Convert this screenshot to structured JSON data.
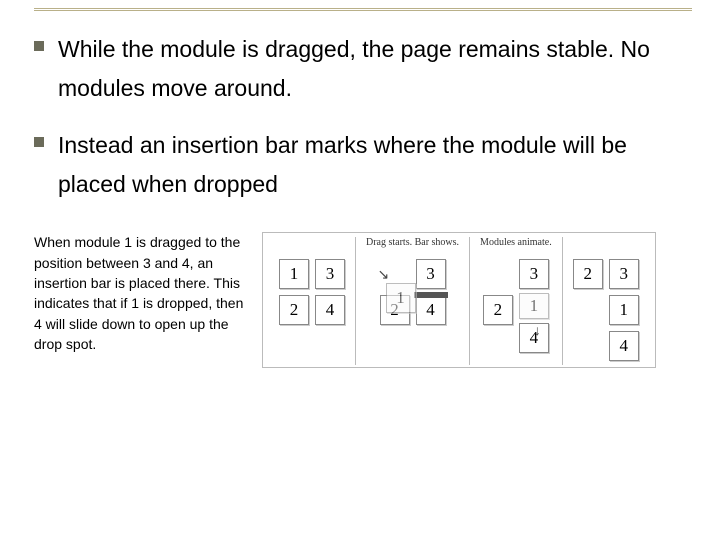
{
  "bullets": [
    "While the module is dragged, the page remains stable. No modules move around.",
    "Instead an insertion bar marks where the module will be placed when dropped"
  ],
  "caption": "When module 1 is dragged to the position between 3 and 4, an insertion bar is placed there. This indicates that if 1 is dropped, then 4 will slide down to open up the drop spot.",
  "diagram": {
    "col1": {
      "label": "",
      "tiles": [
        "1",
        "3",
        "2",
        "4"
      ]
    },
    "col2": {
      "label": "Drag starts. Bar shows.",
      "left": [
        "2"
      ],
      "right": [
        "3",
        "4"
      ],
      "drag": "1"
    },
    "col3": {
      "label": "Modules animate.",
      "left": [
        "2"
      ],
      "right": [
        "3",
        "1",
        "4"
      ]
    },
    "col4": {
      "label": "",
      "left": [
        "2"
      ],
      "right": [
        "3",
        "1",
        "4"
      ]
    }
  }
}
